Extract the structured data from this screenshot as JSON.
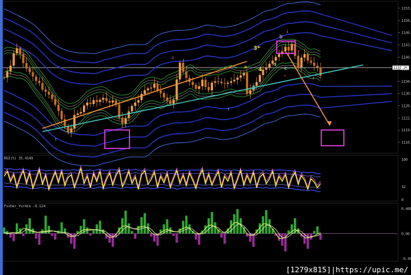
{
  "chart_data": [
    {
      "type": "candlestick",
      "y_axis_ticks": [
        "1153.65",
        "1150.10",
        "1146.55",
        "1143.00",
        "1140.45",
        "1137.25",
        "1134.65",
        "1130.10",
        "1126.75",
        "1122.70",
        "1119.70",
        "1116.65"
      ],
      "current_price_label": "1137.25",
      "price_points": [
        1134.5,
        1136.2,
        1137.8,
        1141.2,
        1142.6,
        1141.0,
        1138.5,
        1137.0,
        1136.0,
        1134.8,
        1133.6,
        1133.0,
        1131.2,
        1130.6,
        1129.8,
        1128.6,
        1127.0,
        1125.3,
        1123.0,
        1121.2,
        1119.4,
        1120.5,
        1124.2,
        1124.6,
        1125.0,
        1126.8,
        1127.6,
        1127.2,
        1128.3,
        1127.8,
        1128.4,
        1128.9,
        1128.1,
        1127.6,
        1128.2,
        1127.1,
        1123.4,
        1121.8,
        1123.3,
        1125.2,
        1126.7,
        1127.6,
        1128.3,
        1130.0,
        1131.0,
        1131.5,
        1131.7,
        1132.8,
        1130.9,
        1130.2,
        1129.0,
        1128.1,
        1127.3,
        1128.4,
        1134.0,
        1138.6,
        1136.2,
        1134.4,
        1133.3,
        1132.5,
        1131.4,
        1132.1,
        1133.9,
        1131.9,
        1131.0,
        1133.1,
        1133.5,
        1133.4,
        1133.0,
        1132.8,
        1133.1,
        1133.5,
        1133.9,
        1134.5,
        1135.1,
        1135.8,
        1130.0,
        1131.0,
        1132.2,
        1133.3,
        1135.2,
        1136.7,
        1137.3,
        1138.3,
        1139.2,
        1140.2,
        1141.0,
        1141.7,
        1143.0,
        1142.0,
        1143.8,
        1140.5,
        1137.3,
        1140.0,
        1141.0,
        1139.2,
        1138.6,
        1137.8,
        1137.3,
        1135.0
      ],
      "wave_labels": [
        "3*",
        "4",
        "5",
        "a",
        "b",
        "c",
        "a"
      ],
      "trendlines": [
        {
          "from": [
            12,
            1120.5
          ],
          "to": [
            76,
            1139.0
          ]
        },
        {
          "from": [
            12,
            1119.6
          ],
          "to": [
            100,
            1135.0
          ]
        }
      ],
      "projection": {
        "from": [
          87,
          1141.5
        ],
        "to": [
          92,
          1121.5
        ]
      }
    },
    {
      "type": "line",
      "title": "RSI(5) 35.4149",
      "y_axis_ticks": [
        "100",
        "32",
        "0"
      ],
      "series_values": [
        58,
        70,
        45,
        62,
        30,
        55,
        72,
        40,
        66,
        28,
        50,
        74,
        38,
        60,
        25,
        48,
        68,
        42,
        70,
        35,
        55,
        62,
        30,
        52,
        78,
        40,
        58,
        30,
        64,
        45,
        70,
        28,
        50,
        66,
        36,
        60,
        74,
        32,
        48,
        70,
        40,
        56,
        26,
        62,
        72,
        38,
        50,
        68,
        30,
        58,
        42,
        64,
        30,
        52,
        72,
        40,
        60,
        35,
        66,
        48,
        28,
        56,
        74,
        40,
        62,
        36,
        54,
        70,
        30,
        58,
        46,
        66,
        28,
        50,
        72,
        36,
        60,
        42,
        68,
        30,
        56,
        64,
        40,
        52,
        70,
        34,
        58,
        46,
        62,
        30,
        54,
        68,
        38,
        60,
        48,
        26,
        52,
        44,
        30,
        40
      ]
    },
    {
      "type": "bar",
      "title": "Fisher_Yur4ik -0.124",
      "y_axis_ticks": [
        "0.488",
        "0.00",
        "-0.491"
      ],
      "series_values": [
        0.12,
        0.05,
        -0.08,
        -0.15,
        0.2,
        0.1,
        -0.05,
        0.18,
        0.3,
        0.1,
        -0.1,
        -0.22,
        0.08,
        0.35,
        0.15,
        -0.05,
        -0.12,
        0.06,
        0.22,
        0.1,
        -0.08,
        -0.2,
        -0.3,
        0.05,
        0.15,
        0.28,
        0.12,
        -0.04,
        0.06,
        0.18,
        0.25,
        0.08,
        -0.1,
        -0.18,
        -0.26,
        -0.08,
        0.12,
        0.3,
        0.45,
        0.2,
        0.05,
        -0.1,
        0.15,
        0.32,
        0.4,
        0.2,
        -0.06,
        -0.16,
        -0.24,
        0.08,
        0.18,
        0.28,
        0.12,
        -0.05,
        -0.18,
        0.1,
        0.25,
        0.35,
        0.18,
        0.05,
        -0.12,
        -0.22,
        0.06,
        0.16,
        0.3,
        0.42,
        0.22,
        0.08,
        -0.08,
        -0.2,
        0.1,
        0.26,
        0.38,
        0.48,
        0.3,
        0.12,
        -0.06,
        -0.16,
        -0.26,
        0.08,
        0.2,
        0.34,
        0.46,
        0.28,
        0.1,
        -0.04,
        -0.14,
        -0.24,
        -0.35,
        0.06,
        0.18,
        0.3,
        0.1,
        -0.06,
        -0.2,
        -0.3,
        -0.12,
        0.05,
        0.14,
        -0.124
      ]
    }
  ],
  "watermark": "[1279x815]|https://upic.me/"
}
